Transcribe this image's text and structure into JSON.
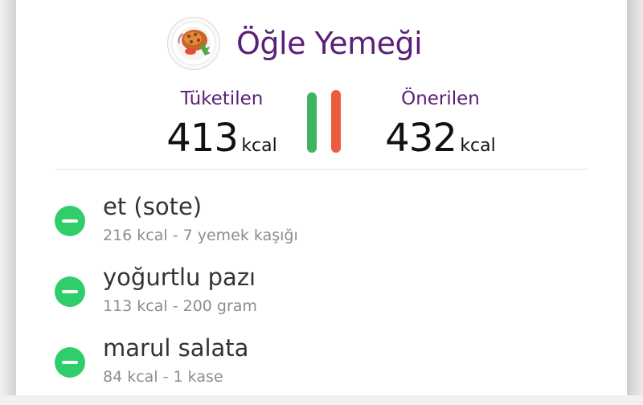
{
  "meal": {
    "title": "Öğle Yemeği",
    "icon": "meal-plate-icon"
  },
  "stats": {
    "consumed": {
      "label": "Tüketilen",
      "value": "413",
      "unit": "kcal",
      "color": "#3cb660"
    },
    "recommended": {
      "label": "Önerilen",
      "value": "432",
      "unit": "kcal",
      "color": "#ee5a3c"
    }
  },
  "foods": [
    {
      "name": "et (sote)",
      "detail": "216 kcal - 7 yemek kaşığı",
      "icon": "minus-icon"
    },
    {
      "name": "yoğurtlu pazı",
      "detail": "113 kcal - 200 gram",
      "icon": "minus-icon"
    },
    {
      "name": "marul salata",
      "detail": "84 kcal - 1 kase",
      "icon": "minus-icon"
    }
  ],
  "colors": {
    "accent_purple": "#5b1f78",
    "remove_green": "#2fce6a"
  }
}
